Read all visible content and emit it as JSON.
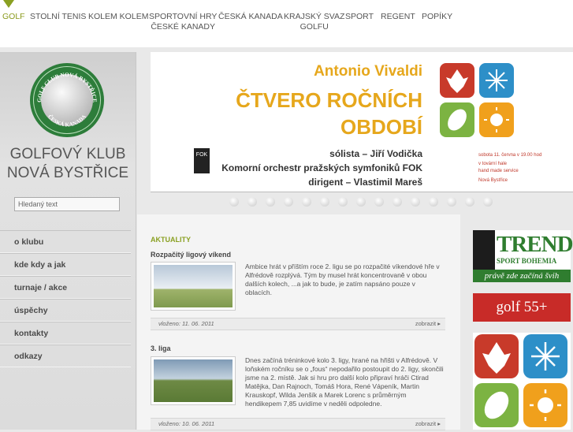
{
  "nav": {
    "items": [
      {
        "label": "GOLF",
        "active": true
      },
      {
        "label": "STOLNÍ TENIS"
      },
      {
        "label": "KOLEM KOLEM"
      },
      {
        "label": "SPORTOVNÍ HRY",
        "label2": "ČESKÉ KANADY"
      },
      {
        "label": "ČESKÁ KANADA"
      },
      {
        "label": "KRAJSKÝ SVAZ",
        "label2": "GOLFU"
      },
      {
        "label": "SPORT"
      },
      {
        "label": "REGENT"
      },
      {
        "label": "POPÍKY"
      }
    ]
  },
  "sidebar": {
    "logo_text_top": "GOLF CLUB NOVÁ BYSTŘICE",
    "logo_text_bottom": "ČESKÁ KANADA",
    "club_line1": "GOLFOVÝ KLUB",
    "club_line2": "NOVÁ BYSTŘICE",
    "search_placeholder": "Hledaný text",
    "menu": [
      "o klubu",
      "kde kdy a jak",
      "turnaje / akce",
      "úspěchy",
      "kontakty",
      "odkazy"
    ]
  },
  "banner": {
    "composer": "Antonio Vivaldi",
    "title1": "ČTVERO ROČNÍCH",
    "title2": "OBDOBÍ",
    "soloist": "sólista – Jiří Vodička",
    "orchestra": "Komorní orchestr pražských symfoniků FOK",
    "conductor": "dirigent – Vlastimil Mareš",
    "fok_logo": "FOK",
    "event_line1": "sobota 11. června v 19.00 hod",
    "event_line2": "v tovární hale",
    "event_line3": "hand made service",
    "event_line4": "Nová Bystřice",
    "slide_count": 15
  },
  "news": {
    "heading": "AKTUALITY",
    "articles": [
      {
        "title": "Rozpačitý ligový víkend",
        "text": "Ambice hrát v příštím roce 2. ligu se po rozpačité víkendové hře v Alfrédově rozplývá. Tým by musel hrát koncentrovaně v obou dalších kolech, ...a jak to bude, je zatím napsáno pouze v oblacích.",
        "date": "vloženo: 11. 06. 2011",
        "more": "zobrazit"
      },
      {
        "title": "3. liga",
        "text": "Dnes začíná tréninkové kolo 3. ligy, hrané na hřišti v Alfrédově. V loňském ročníku se o „fous“ nepodařilo postoupit do 2. ligy, skončili jsme na 2. místě. Jak si hru pro další kolo připraví hráči Ctirad Matějka, Dan Rajnoch, Tomáš Hora, René Vápeník, Martin Krauskopf, Wilda Jenšík a Marek Lorenc s průměrným hendikepem 7,85 uvidíme v neděli odpoledne.",
        "date": "vloženo: 10. 06. 2011",
        "more": "zobrazit"
      }
    ]
  },
  "ads": {
    "trend_title": "TREND",
    "trend_sub": "SPORT BOHEMIA",
    "trend_slogan": "právě zde začíná švih",
    "golf55": "golf 55+"
  },
  "colors": {
    "accent_green": "#8aa022",
    "banner_orange": "#e6a71c",
    "golf55_red": "#c82b28",
    "trend_green": "#2f7d2f"
  }
}
